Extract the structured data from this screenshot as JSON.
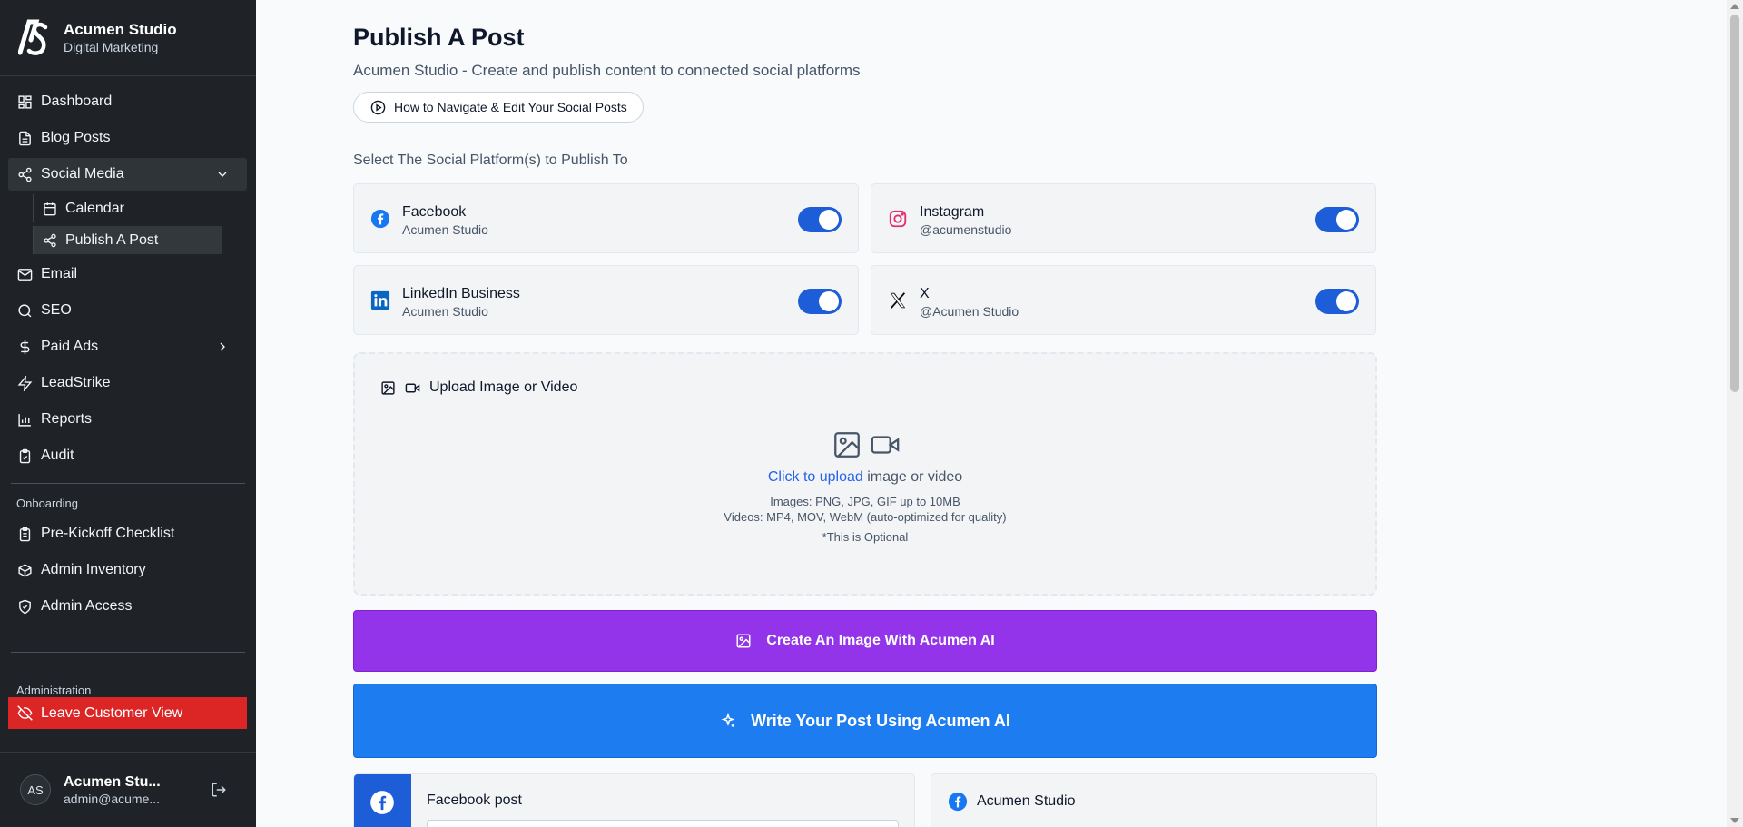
{
  "brand": {
    "logo_text": "AS",
    "name": "Acumen Studio",
    "subtitle": "Digital Marketing"
  },
  "sidebar": {
    "items": [
      {
        "label": "Dashboard",
        "icon": "dashboard-icon"
      },
      {
        "label": "Blog Posts",
        "icon": "document-icon"
      },
      {
        "label": "Social Media",
        "icon": "share-icon",
        "expanded": true
      },
      {
        "label": "Email",
        "icon": "mail-icon"
      },
      {
        "label": "SEO",
        "icon": "search-icon"
      },
      {
        "label": "Paid Ads",
        "icon": "dollar-icon"
      },
      {
        "label": "LeadStrike",
        "icon": "lightning-icon"
      },
      {
        "label": "Reports",
        "icon": "bar-chart-icon"
      },
      {
        "label": "Audit",
        "icon": "clipboard-check-icon"
      }
    ],
    "social_sub": [
      {
        "label": "Calendar",
        "icon": "calendar-icon"
      },
      {
        "label": "Publish A Post",
        "icon": "share-icon",
        "active": true
      }
    ],
    "onboarding_label": "Onboarding",
    "onboarding_items": [
      {
        "label": "Pre-Kickoff Checklist",
        "icon": "clipboard-list-icon"
      },
      {
        "label": "Admin Inventory",
        "icon": "box-icon"
      },
      {
        "label": "Admin Access",
        "icon": "shield-check-icon"
      }
    ],
    "administration_label": "Administration",
    "leave_label": "Leave Customer View"
  },
  "user": {
    "initials": "AS",
    "name": "Acumen Stu...",
    "email": "admin@acume..."
  },
  "main": {
    "title": "Publish A Post",
    "subtitle": "Acumen Studio - Create and publish content to connected social platforms",
    "howto_label": "How to Navigate & Edit Your Social Posts",
    "select_label": "Select The Social Platform(s) to Publish To",
    "platforms": [
      {
        "name": "Facebook",
        "account": "Acumen Studio",
        "enabled": true,
        "color": "#1877f2"
      },
      {
        "name": "Instagram",
        "account": "@acumenstudio",
        "enabled": true,
        "color": "#e1306c"
      },
      {
        "name": "LinkedIn Business",
        "account": "Acumen Studio",
        "enabled": true,
        "color": "#0a66c2"
      },
      {
        "name": "X",
        "account": "@Acumen Studio",
        "enabled": true,
        "color": "#000000"
      }
    ],
    "upload": {
      "heading": "Upload Image or Video",
      "click_link": "Click to upload",
      "click_rest": " image or video",
      "images_note": "Images: PNG, JPG, GIF up to 10MB",
      "videos_note": "Videos: MP4, MOV, WebM (auto-optimized for quality)",
      "optional_note": "*This is Optional"
    },
    "create_image_label": "Create An Image With Acumen AI",
    "write_post_label": "Write Your Post Using Acumen AI",
    "facebook_post_title": "Facebook post",
    "preview_name": "Acumen Studio",
    "accent_purple": "#9333ea",
    "accent_blue": "#1d7cf0",
    "toggle_color": "#1d5ed8",
    "leave_color": "#dc2626"
  }
}
